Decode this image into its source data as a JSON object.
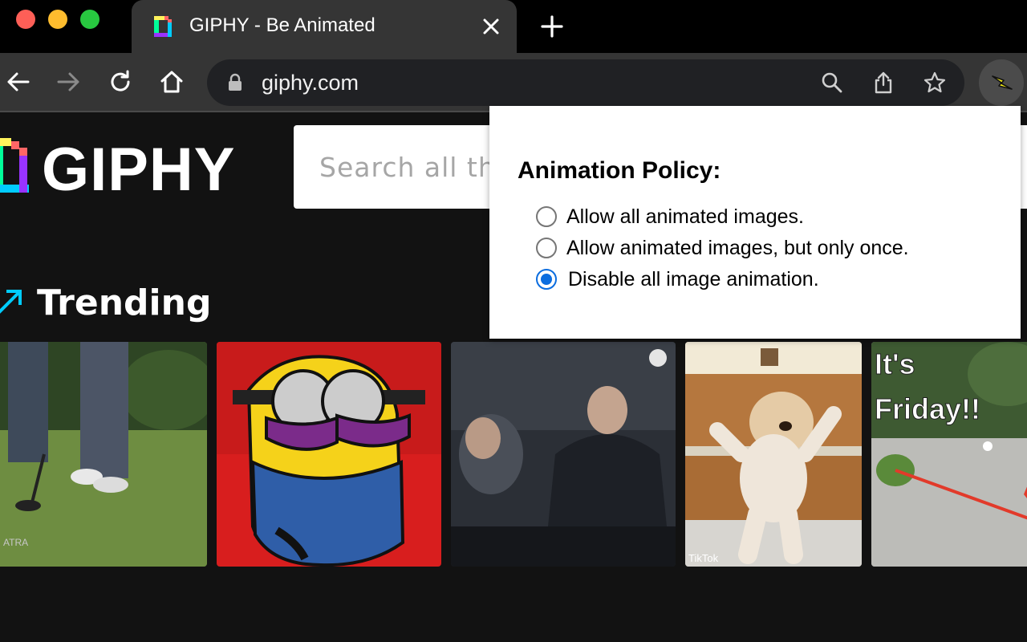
{
  "browser": {
    "tab": {
      "title": "GIPHY - Be Animated"
    },
    "address_bar": {
      "url": "giphy.com"
    }
  },
  "page": {
    "logo_text": "GIPHY",
    "search": {
      "placeholder": "Search all the GIFs and Stickers"
    },
    "trending_title": "Trending",
    "gifs": [
      {
        "name": "golf-gif",
        "overlay_text": "ATRA"
      },
      {
        "name": "minion-gif",
        "overlay_text": ""
      },
      {
        "name": "stadium-gif",
        "overlay_text": ""
      },
      {
        "name": "teddy-bear-gif",
        "overlay_text": "TikTok"
      },
      {
        "name": "friday-gif",
        "overlay_text": "It's Friday!!"
      }
    ]
  },
  "popup": {
    "title": "Animation Policy:",
    "options": [
      {
        "label": "Allow all animated images.",
        "selected": false
      },
      {
        "label": "Allow animated images, but only once.",
        "selected": false
      },
      {
        "label": "Disable all image animation.",
        "selected": true
      }
    ]
  },
  "colors": {
    "page_background": "#121212",
    "radio_selected": "#0b6ddf",
    "trending_accent": "#00ccff"
  }
}
